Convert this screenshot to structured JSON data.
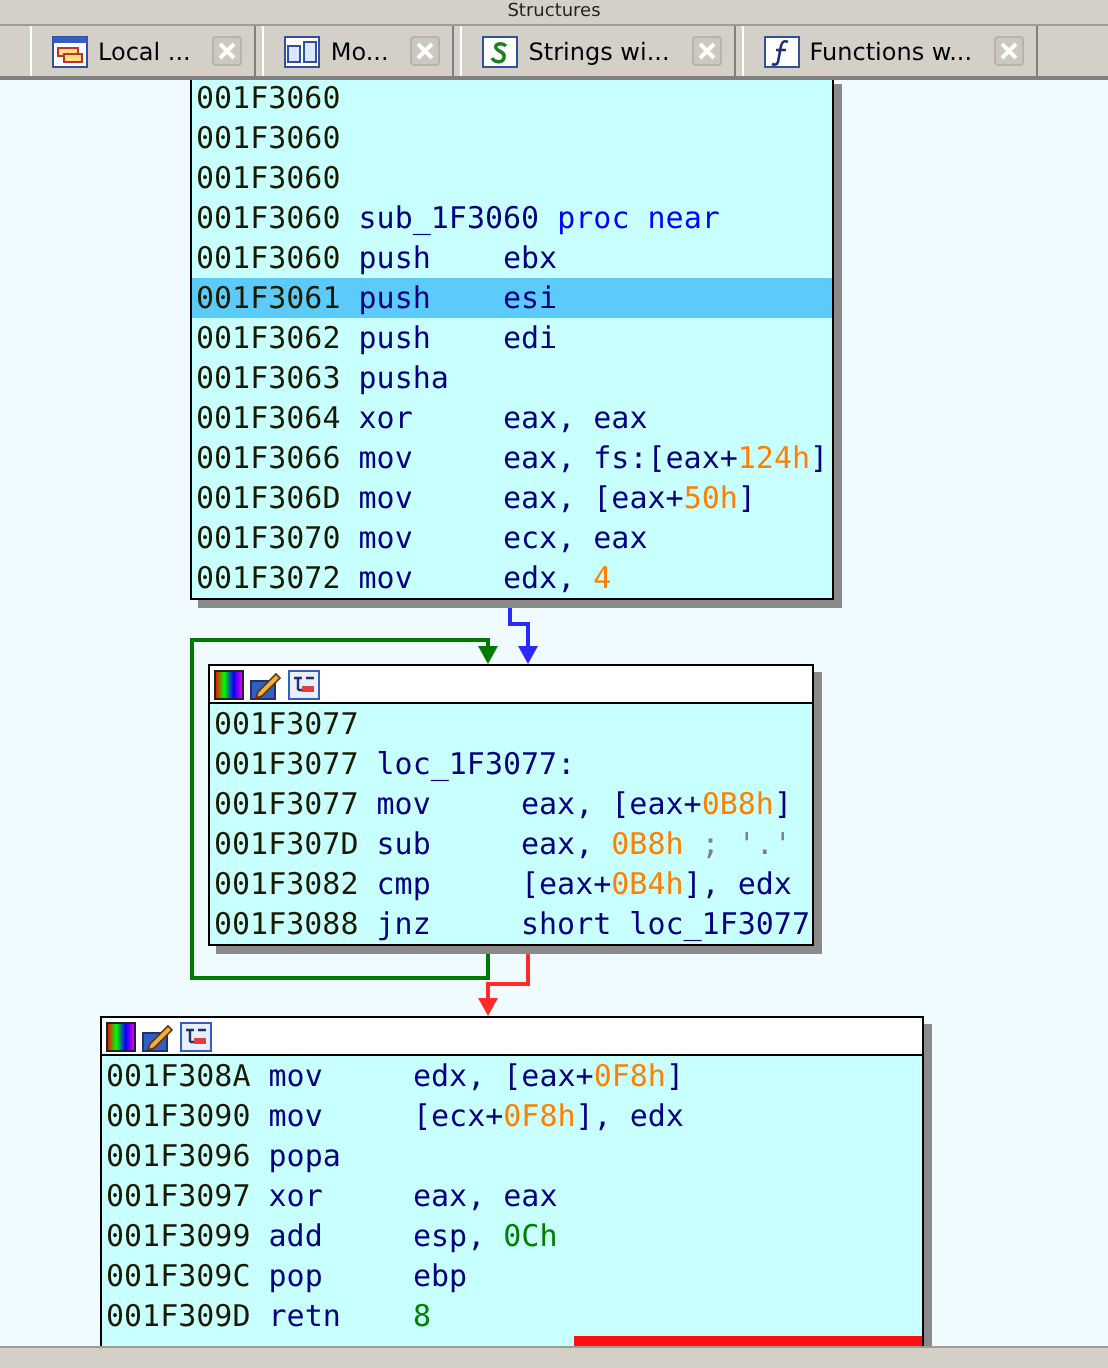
{
  "top_strip": {
    "title": "Structures"
  },
  "tabs": [
    {
      "label": "Local ..."
    },
    {
      "label": "Mo..."
    },
    {
      "label": "Strings wi..."
    },
    {
      "label": "Functions w..."
    }
  ],
  "graph": {
    "edges": [
      {
        "color": "#2a2aff"
      },
      {
        "color": "#007a00"
      },
      {
        "color": "#ff2a2a"
      }
    ],
    "nodes": [
      {
        "kind": "entry",
        "lines": [
          {
            "address": "001F3060",
            "selected": false
          },
          {
            "address": "001F3060",
            "selected": false
          },
          {
            "address": "001F3060",
            "selected": false
          },
          {
            "address": "001F3060",
            "selected": false,
            "tokens": [
              {
                "text": "sub_1F3060 ",
                "kind": "name"
              },
              {
                "text": "proc near",
                "kind": "keyword"
              }
            ]
          },
          {
            "address": "001F3060",
            "mnemonic": "push",
            "selected": false,
            "tokens": [
              {
                "text": "ebx",
                "kind": "reg"
              }
            ]
          },
          {
            "address": "001F3061",
            "mnemonic": "push",
            "selected": true,
            "tokens": [
              {
                "text": "esi",
                "kind": "reg"
              }
            ]
          },
          {
            "address": "001F3062",
            "mnemonic": "push",
            "selected": false,
            "tokens": [
              {
                "text": "edi",
                "kind": "reg"
              }
            ]
          },
          {
            "address": "001F3063",
            "mnemonic": "pusha",
            "selected": false
          },
          {
            "address": "001F3064",
            "mnemonic": "xor",
            "selected": false,
            "tokens": [
              {
                "text": "eax, eax",
                "kind": "reg"
              }
            ]
          },
          {
            "address": "001F3066",
            "mnemonic": "mov",
            "selected": false,
            "tokens": [
              {
                "text": "eax, fs:[eax+",
                "kind": "reg"
              },
              {
                "text": "124h",
                "kind": "hex"
              },
              {
                "text": "]",
                "kind": "reg"
              }
            ]
          },
          {
            "address": "001F306D",
            "mnemonic": "mov",
            "selected": false,
            "tokens": [
              {
                "text": "eax, [eax+",
                "kind": "reg"
              },
              {
                "text": "50h",
                "kind": "hex"
              },
              {
                "text": "]",
                "kind": "reg"
              }
            ]
          },
          {
            "address": "001F3070",
            "mnemonic": "mov",
            "selected": false,
            "tokens": [
              {
                "text": "ecx, eax",
                "kind": "reg"
              }
            ]
          },
          {
            "address": "001F3072",
            "mnemonic": "mov",
            "selected": false,
            "tokens": [
              {
                "text": "edx, ",
                "kind": "reg"
              },
              {
                "text": "4",
                "kind": "hex"
              }
            ]
          }
        ]
      },
      {
        "kind": "block",
        "lines": [
          {
            "address": "001F3077",
            "selected": false
          },
          {
            "address": "001F3077",
            "selected": false,
            "tokens": [
              {
                "text": "loc_1F3077:",
                "kind": "name"
              }
            ]
          },
          {
            "address": "001F3077",
            "mnemonic": "mov",
            "selected": false,
            "tokens": [
              {
                "text": "eax, [eax+",
                "kind": "reg"
              },
              {
                "text": "0B8h",
                "kind": "hex"
              },
              {
                "text": "]",
                "kind": "reg"
              }
            ]
          },
          {
            "address": "001F307D",
            "mnemonic": "sub",
            "selected": false,
            "tokens": [
              {
                "text": "eax, ",
                "kind": "reg"
              },
              {
                "text": "0B8h",
                "kind": "hex"
              },
              {
                "text": " ; '.'",
                "kind": "comment"
              }
            ]
          },
          {
            "address": "001F3082",
            "mnemonic": "cmp",
            "selected": false,
            "tokens": [
              {
                "text": "[eax+",
                "kind": "reg"
              },
              {
                "text": "0B4h",
                "kind": "hex"
              },
              {
                "text": "], edx",
                "kind": "reg"
              }
            ]
          },
          {
            "address": "001F3088",
            "mnemonic": "jnz",
            "selected": false,
            "tokens": [
              {
                "text": "short loc_1F3077",
                "kind": "reg"
              }
            ]
          }
        ]
      },
      {
        "kind": "exit",
        "lines": [
          {
            "address": "001F308A",
            "mnemonic": "mov",
            "selected": false,
            "tokens": [
              {
                "text": "edx, [eax+",
                "kind": "reg"
              },
              {
                "text": "0F8h",
                "kind": "hex"
              },
              {
                "text": "]",
                "kind": "reg"
              }
            ]
          },
          {
            "address": "001F3090",
            "mnemonic": "mov",
            "selected": false,
            "tokens": [
              {
                "text": "[ecx+",
                "kind": "reg"
              },
              {
                "text": "0F8h",
                "kind": "hex"
              },
              {
                "text": "], edx",
                "kind": "reg"
              }
            ]
          },
          {
            "address": "001F3096",
            "mnemonic": "popa",
            "selected": false
          },
          {
            "address": "001F3097",
            "mnemonic": "xor",
            "selected": false,
            "tokens": [
              {
                "text": "eax, eax",
                "kind": "reg"
              }
            ]
          },
          {
            "address": "001F3099",
            "mnemonic": "add",
            "selected": false,
            "tokens": [
              {
                "text": "esp, ",
                "kind": "reg"
              },
              {
                "text": "0Ch",
                "kind": "num"
              }
            ]
          },
          {
            "address": "001F309C",
            "mnemonic": "pop",
            "selected": false,
            "tokens": [
              {
                "text": "ebp",
                "kind": "reg"
              }
            ]
          },
          {
            "address": "001F309D",
            "mnemonic": "retn",
            "selected": false,
            "tokens": [
              {
                "text": "8",
                "kind": "num"
              }
            ]
          }
        ]
      }
    ]
  }
}
